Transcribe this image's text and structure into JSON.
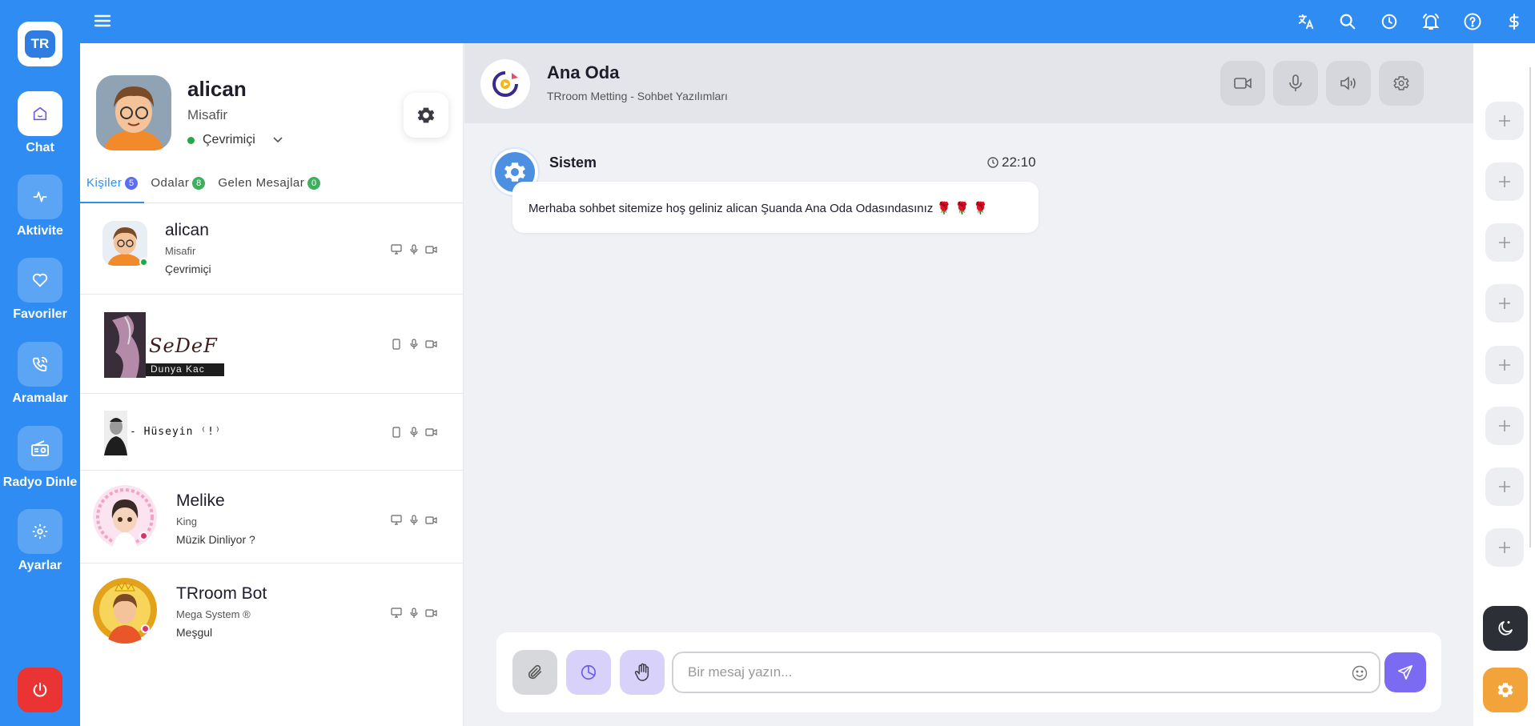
{
  "rail": {
    "logo_text": "TR",
    "items": [
      {
        "label": "Chat"
      },
      {
        "label": "Aktivite"
      },
      {
        "label": "Favoriler"
      },
      {
        "label": "Aramalar"
      },
      {
        "label": "Radyo Dinle"
      },
      {
        "label": "Ayarlar"
      }
    ]
  },
  "topbar": {
    "icons": [
      "translate-icon",
      "search-icon",
      "clock-icon",
      "bell-icon",
      "help-icon",
      "dollar-icon"
    ]
  },
  "profile": {
    "name": "alican",
    "role": "Misafir",
    "status": "Çevrimiçi",
    "status_color": "#26a84a"
  },
  "tabs": [
    {
      "label": "Kişiler",
      "count": "5"
    },
    {
      "label": "Odalar",
      "count": "8"
    },
    {
      "label": "Gelen Mesajlar",
      "count": "0"
    }
  ],
  "contacts": [
    {
      "name": "alican",
      "role": "Misafir",
      "status": "Çevrimiçi"
    },
    {
      "image_text": "SeDeF",
      "image_caption": "Dunya Kac"
    },
    {
      "image_text": "- Hüseyin ⁽!⁾"
    },
    {
      "name": "Melike",
      "role": "King",
      "status": "Müzik Dinliyor ?"
    },
    {
      "name": "TRroom Bot",
      "role": "Mega System ®",
      "status": "Meşgul"
    }
  ],
  "room": {
    "name": "Ana Oda",
    "subtitle": "TRroom Metting - Sohbet Yazılımları"
  },
  "message": {
    "sender": "Sistem",
    "time": "22:10",
    "text": "Merhaba sohbet sitemize hoş geliniz alican Şuanda Ana Oda Odasındasınız 🌹 🌹 🌹"
  },
  "composer": {
    "placeholder": "Bir mesaj yazın..."
  },
  "colors": {
    "primary": "#2f8cf2",
    "send": "#7b6af2",
    "danger": "#ea3434",
    "accent_orange": "#f2a43a"
  }
}
